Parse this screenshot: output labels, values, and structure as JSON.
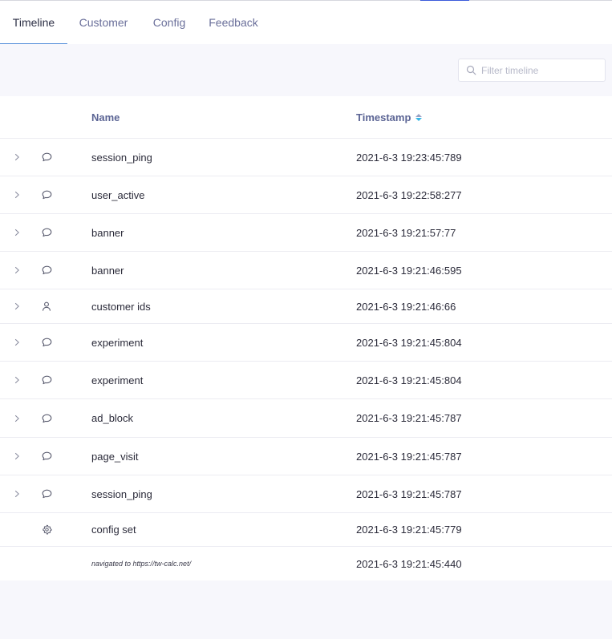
{
  "tabs": [
    {
      "label": "Timeline",
      "active": true
    },
    {
      "label": "Customer",
      "active": false
    },
    {
      "label": "Config",
      "active": false
    },
    {
      "label": "Feedback",
      "active": false
    }
  ],
  "filter": {
    "placeholder": "Filter timeline",
    "value": ""
  },
  "table": {
    "columns": {
      "name": "Name",
      "timestamp": "Timestamp"
    },
    "sort": {
      "column": "timestamp",
      "direction": "descending"
    },
    "rows": [
      {
        "name": "session_ping",
        "timestamp": "2021-6-3 19:23:45:789",
        "icon": "chat-bubble-icon",
        "expandable": true
      },
      {
        "name": "user_active",
        "timestamp": "2021-6-3 19:22:58:277",
        "icon": "chat-bubble-icon",
        "expandable": true
      },
      {
        "name": "banner",
        "timestamp": "2021-6-3 19:21:57:77",
        "icon": "chat-bubble-icon",
        "expandable": true
      },
      {
        "name": "banner",
        "timestamp": "2021-6-3 19:21:46:595",
        "icon": "chat-bubble-icon",
        "expandable": true
      },
      {
        "name": "customer ids",
        "timestamp": "2021-6-3 19:21:46:66",
        "icon": "user-icon",
        "expandable": true
      },
      {
        "name": "experiment",
        "timestamp": "2021-6-3 19:21:45:804",
        "icon": "chat-bubble-icon",
        "expandable": true
      },
      {
        "name": "experiment",
        "timestamp": "2021-6-3 19:21:45:804",
        "icon": "chat-bubble-icon",
        "expandable": true
      },
      {
        "name": "ad_block",
        "timestamp": "2021-6-3 19:21:45:787",
        "icon": "chat-bubble-icon",
        "expandable": true
      },
      {
        "name": "page_visit",
        "timestamp": "2021-6-3 19:21:45:787",
        "icon": "chat-bubble-icon",
        "expandable": true
      },
      {
        "name": "session_ping",
        "timestamp": "2021-6-3 19:21:45:787",
        "icon": "chat-bubble-icon",
        "expandable": true
      },
      {
        "name": "config set",
        "timestamp": "2021-6-3 19:21:45:779",
        "icon": "gear-icon",
        "expandable": false
      },
      {
        "name": "navigated to https://tw-calc.net/",
        "timestamp": "2021-6-3 19:21:45:440",
        "icon": "",
        "expandable": false
      }
    ]
  },
  "colors": {
    "accent": "#3b5bdb",
    "header_text": "#5b6494",
    "tab_text": "#6a6f9a",
    "sort_active": "#35b6e6",
    "page_background": "#f7f7fc"
  }
}
